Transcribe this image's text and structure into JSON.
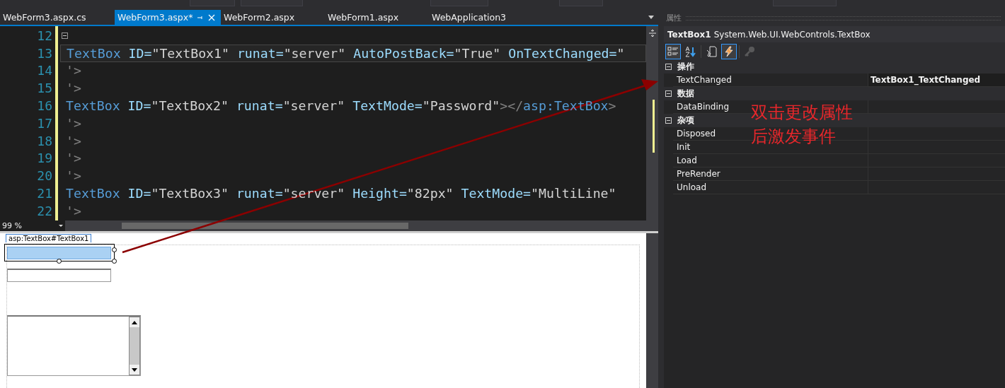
{
  "tabs": [
    {
      "label": "WebForm3.aspx.cs",
      "selected": false
    },
    {
      "label": "WebForm3.aspx*",
      "selected": true
    },
    {
      "label": "WebForm2.aspx",
      "selected": false
    },
    {
      "label": "WebForm1.aspx",
      "selected": false
    },
    {
      "label": "WebApplication3",
      "selected": false
    }
  ],
  "editor": {
    "lines": [
      {
        "number": "12",
        "current": false,
        "collapsible": true
      },
      {
        "number": "13",
        "current": true,
        "collapsible": false,
        "tokens": [
          {
            "kind": "element",
            "text": "TextBox"
          },
          {
            "kind": "attr",
            "text": " ID="
          },
          {
            "kind": "value",
            "text": "\"TextBox1\""
          },
          {
            "kind": "attr",
            "text": " runat="
          },
          {
            "kind": "value",
            "text": "\"server\""
          },
          {
            "kind": "attr",
            "text": " AutoPostBack="
          },
          {
            "kind": "value",
            "text": "\"True\""
          },
          {
            "kind": "attr",
            "text": " OnTextChanged="
          },
          {
            "kind": "value",
            "text": "\""
          }
        ]
      },
      {
        "number": "14",
        "current": false,
        "collapsible": false,
        "tokens": [
          {
            "kind": "punct",
            "text": "'>"
          }
        ]
      },
      {
        "number": "15",
        "current": false,
        "collapsible": false,
        "tokens": [
          {
            "kind": "punct",
            "text": "'>"
          }
        ]
      },
      {
        "number": "16",
        "current": false,
        "collapsible": false,
        "tokens": [
          {
            "kind": "element",
            "text": "TextBox"
          },
          {
            "kind": "attr",
            "text": " ID="
          },
          {
            "kind": "value",
            "text": "\"TextBox2\""
          },
          {
            "kind": "attr",
            "text": " runat="
          },
          {
            "kind": "value",
            "text": "\"server\""
          },
          {
            "kind": "attr",
            "text": " TextMode="
          },
          {
            "kind": "value",
            "text": "\"Password\""
          },
          {
            "kind": "punct",
            "text": "></"
          },
          {
            "kind": "element",
            "text": "asp:TextBox"
          },
          {
            "kind": "punct",
            "text": ">"
          }
        ]
      },
      {
        "number": "17",
        "current": false,
        "collapsible": false,
        "tokens": [
          {
            "kind": "punct",
            "text": "'>"
          }
        ]
      },
      {
        "number": "18",
        "current": false,
        "collapsible": false,
        "tokens": [
          {
            "kind": "punct",
            "text": "'>"
          }
        ]
      },
      {
        "number": "19",
        "current": false,
        "collapsible": false,
        "tokens": [
          {
            "kind": "punct",
            "text": "'>"
          }
        ]
      },
      {
        "number": "20",
        "current": false,
        "collapsible": false,
        "tokens": [
          {
            "kind": "punct",
            "text": "'>"
          }
        ]
      },
      {
        "number": "21",
        "current": false,
        "collapsible": false,
        "tokens": [
          {
            "kind": "element",
            "text": "TextBox"
          },
          {
            "kind": "attr",
            "text": " ID="
          },
          {
            "kind": "value",
            "text": "\"TextBox3\""
          },
          {
            "kind": "attr",
            "text": " runat="
          },
          {
            "kind": "value",
            "text": "\"server\""
          },
          {
            "kind": "attr",
            "text": " Height="
          },
          {
            "kind": "value",
            "text": "\"82px\""
          },
          {
            "kind": "attr",
            "text": " TextMode="
          },
          {
            "kind": "value",
            "text": "\"MultiLine\""
          }
        ]
      },
      {
        "number": "22",
        "current": false,
        "collapsible": false,
        "tokens": [
          {
            "kind": "punct",
            "text": "'>"
          }
        ]
      }
    ],
    "zoom": "99 %"
  },
  "design_view": {
    "tag_label": "asp:TextBox#TextBox1",
    "controls": [
      {
        "kind": "textbox",
        "selected": true
      },
      {
        "kind": "textbox",
        "selected": false
      },
      {
        "kind": "multiline",
        "selected": false
      }
    ]
  },
  "properties": {
    "title": "属性",
    "object_name": "TextBox1",
    "object_type": "System.Web.UI.WebControls.TextBox",
    "toolbar": [
      {
        "kind": "categorized",
        "selected": true,
        "disabled": false
      },
      {
        "kind": "alphabetical",
        "selected": false,
        "disabled": false
      },
      {
        "kind": "properties",
        "selected": false,
        "disabled": false
      },
      {
        "kind": "events",
        "selected": true,
        "disabled": false
      },
      {
        "kind": "property_pages",
        "selected": false,
        "disabled": true
      }
    ],
    "categories": [
      {
        "name": "操作",
        "expanded": true,
        "rows": [
          {
            "name": "TextChanged",
            "value": "TextBox1_TextChanged"
          }
        ]
      },
      {
        "name": "数据",
        "expanded": true,
        "rows": [
          {
            "name": "DataBinding"
          }
        ]
      },
      {
        "name": "杂项",
        "expanded": true,
        "rows": [
          {
            "name": "Disposed"
          },
          {
            "name": "Init"
          },
          {
            "name": "Load"
          },
          {
            "name": "PreRender"
          },
          {
            "name": "Unload"
          }
        ]
      }
    ]
  },
  "annotation": {
    "lines": [
      "双击更改属性",
      "后激发事件"
    ]
  }
}
